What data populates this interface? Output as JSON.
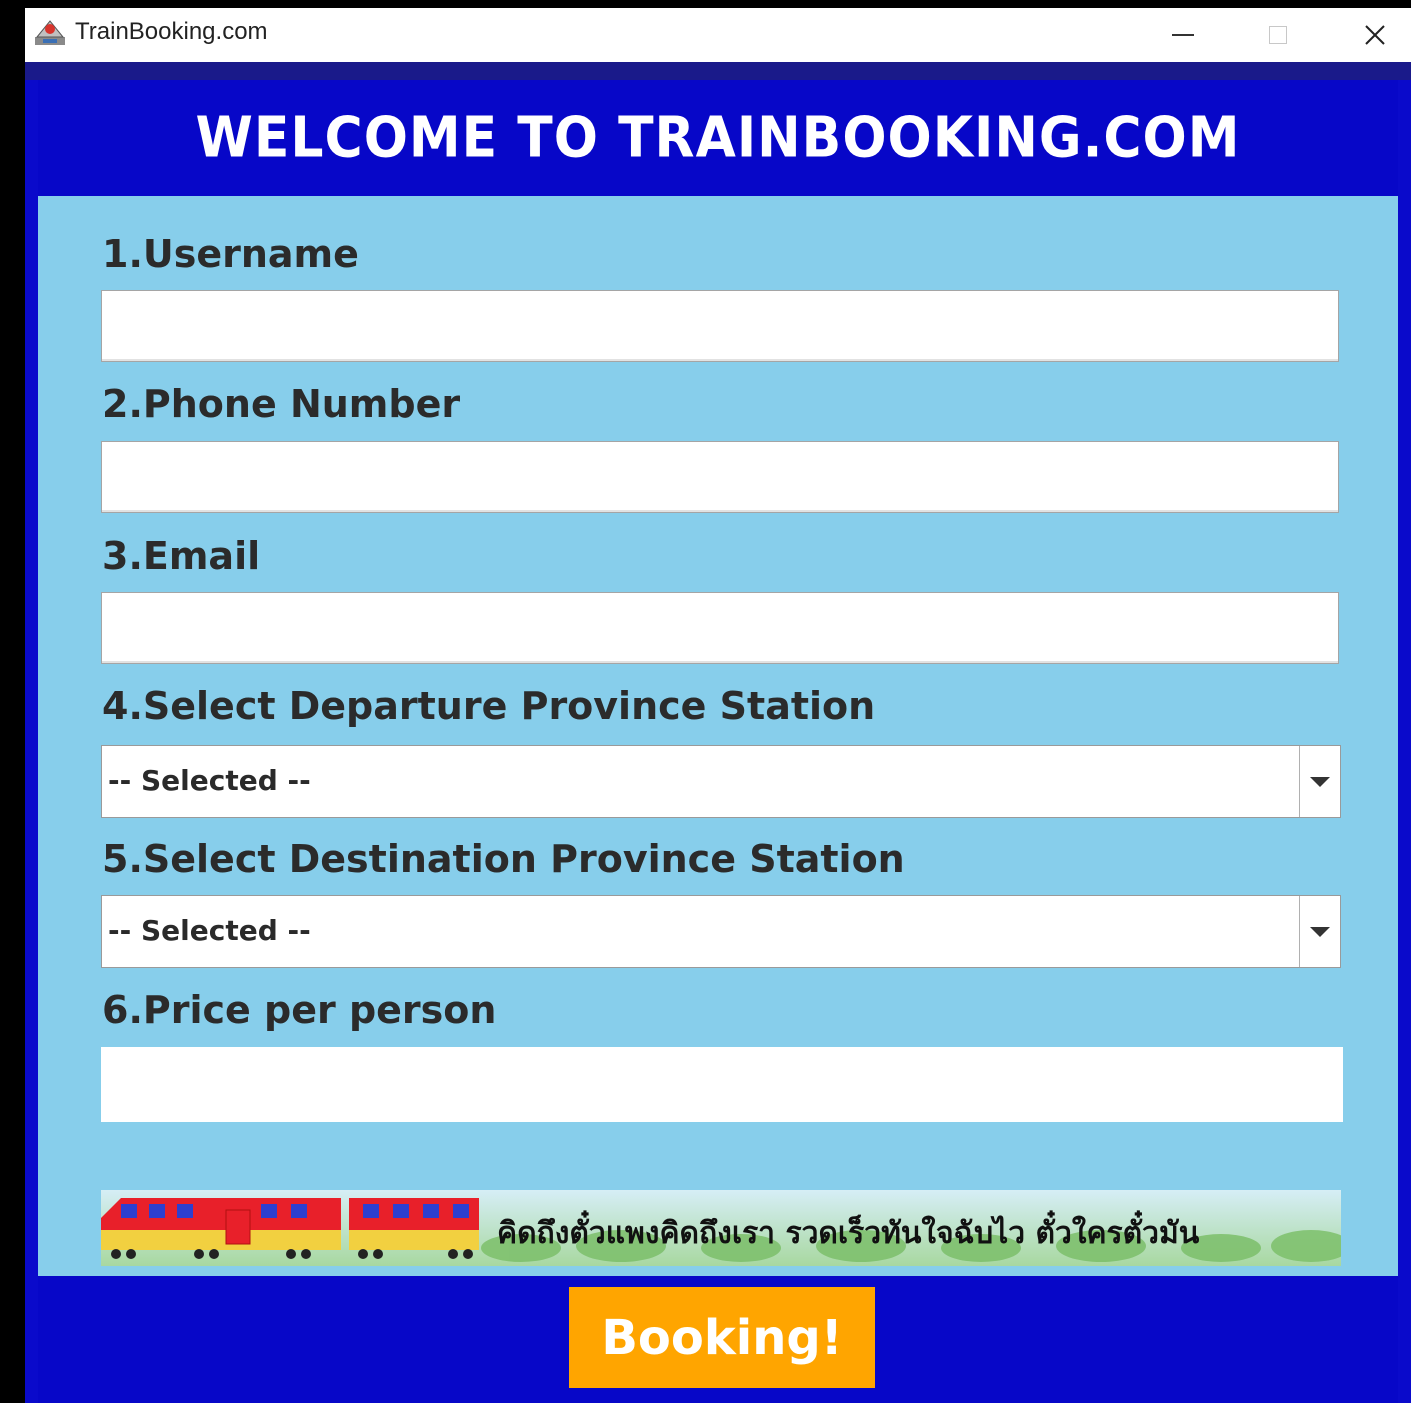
{
  "window": {
    "title": "TrainBooking.com",
    "controls": {
      "minimize": "minimize-icon",
      "maximize": "maximize-icon",
      "close": "close-icon",
      "close_glyph": "✕"
    }
  },
  "header": {
    "title": "WELCOME TO TRAINBOOKING.COM"
  },
  "form": {
    "username": {
      "label": "1.Username",
      "value": ""
    },
    "phone": {
      "label": "2.Phone Number",
      "value": ""
    },
    "email": {
      "label": "3.Email",
      "value": ""
    },
    "departure": {
      "label": "4.Select Departure Province Station",
      "selected": "-- Selected --"
    },
    "destination": {
      "label": "5.Select Destination Province Station",
      "selected": "-- Selected --"
    },
    "price": {
      "label": "6.Price per person",
      "value": ""
    }
  },
  "banner": {
    "text": "คิดถึงตั๋วแพงคิดถึงเรา รวดเร็วทันใจฉับไว ตั๋วใครตั๋วมัน"
  },
  "actions": {
    "booking_label": "Booking!"
  },
  "colors": {
    "header_bg": "#0707c8",
    "form_bg": "#87ceeb",
    "button_bg": "#ffa500",
    "train_red": "#e8202a",
    "train_yellow": "#f2d040"
  }
}
